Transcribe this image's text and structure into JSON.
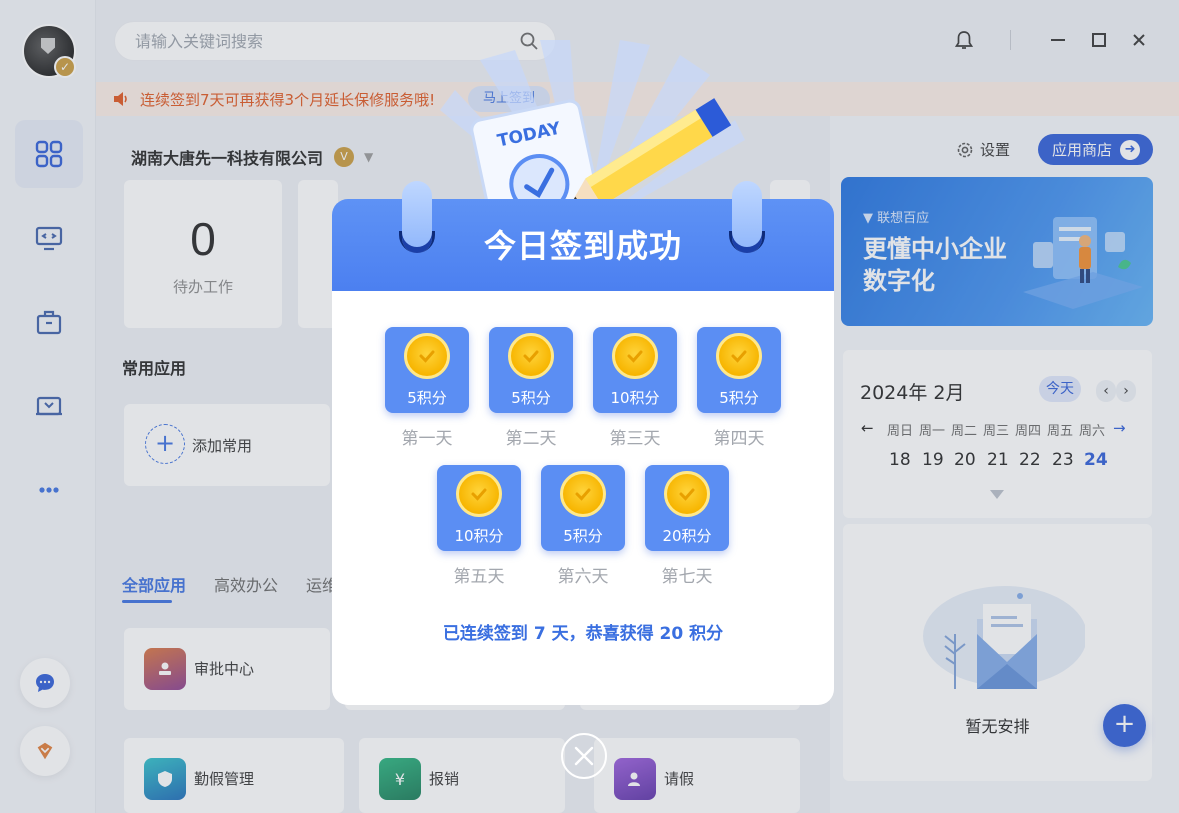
{
  "search": {
    "placeholder": "请输入关键词搜索"
  },
  "notice": {
    "text": "连续签到7天可再获得3个月延长保修服务哦!",
    "button": "马上签到"
  },
  "company": {
    "name": "湖南大唐先一科技有限公司",
    "badge": "V"
  },
  "stats": [
    {
      "value": "0",
      "label": "待办工作"
    }
  ],
  "common_apps": {
    "title": "常用应用",
    "add_label": "添加常用"
  },
  "app_tabs": [
    "全部应用",
    "高效办公",
    "运维"
  ],
  "apps": [
    {
      "label": "审批中心",
      "icon": "approval-icon",
      "color": "#b9532b"
    },
    {
      "label": "勤假管理",
      "icon": "leave-management-icon",
      "color": "#1aa7b5"
    },
    {
      "label": "报销",
      "icon": "reimbursement-icon",
      "color": "#1e9b6a"
    },
    {
      "label": "请假",
      "icon": "request-leave-icon",
      "color": "#7b49c9"
    }
  ],
  "right": {
    "settings": "设置",
    "store": "应用商店",
    "banner": {
      "brand": "联想百应",
      "line1": "更懂中小企业",
      "line2": "数字化"
    },
    "calendar": {
      "month": "2024年 2月",
      "today": "今天",
      "weekdays": [
        "周日",
        "周一",
        "周二",
        "周三",
        "周四",
        "周五",
        "周六"
      ],
      "days": [
        "18",
        "19",
        "20",
        "21",
        "22",
        "23",
        "24"
      ],
      "selected": "24"
    },
    "empty": "暂无安排"
  },
  "modal": {
    "art_label": "TODAY",
    "title": "今日签到成功",
    "days": [
      {
        "points": "5积分",
        "label": "第一天"
      },
      {
        "points": "5积分",
        "label": "第二天"
      },
      {
        "points": "10积分",
        "label": "第三天"
      },
      {
        "points": "5积分",
        "label": "第四天"
      },
      {
        "points": "10积分",
        "label": "第五天"
      },
      {
        "points": "5积分",
        "label": "第六天"
      },
      {
        "points": "20积分",
        "label": "第七天"
      }
    ],
    "summary": "已连续签到 7 天，恭喜获得 20 积分"
  },
  "colors": {
    "accent": "#3a6fe0",
    "notice_text": "#e0541b",
    "coin": "#f7b500",
    "tile": "#5b8ef3"
  }
}
